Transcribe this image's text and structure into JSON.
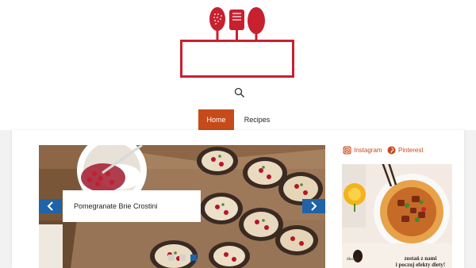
{
  "nav": {
    "items": [
      {
        "label": "Home",
        "active": true
      },
      {
        "label": "Recipes",
        "active": false
      }
    ]
  },
  "slider": {
    "caption": "Pomegranate Brie Crostini",
    "dot_count": 3,
    "active_dot": 2
  },
  "social": {
    "instagram": "Instagram",
    "pinterest": "Pinterest"
  },
  "ad": {
    "line1": "zostań z nami",
    "line2": "i poczuj efekty",
    "line3": "diety!",
    "brand": "Maczfit"
  },
  "colors": {
    "logo_red": "#c8202f",
    "accent": "#c74a1b",
    "arrow_blue": "#1f63a8"
  },
  "icons": {
    "search": "search-icon",
    "prev": "chevron-left-icon",
    "next": "chevron-right-icon",
    "instagram": "instagram-icon",
    "pinterest": "pinterest-icon"
  }
}
